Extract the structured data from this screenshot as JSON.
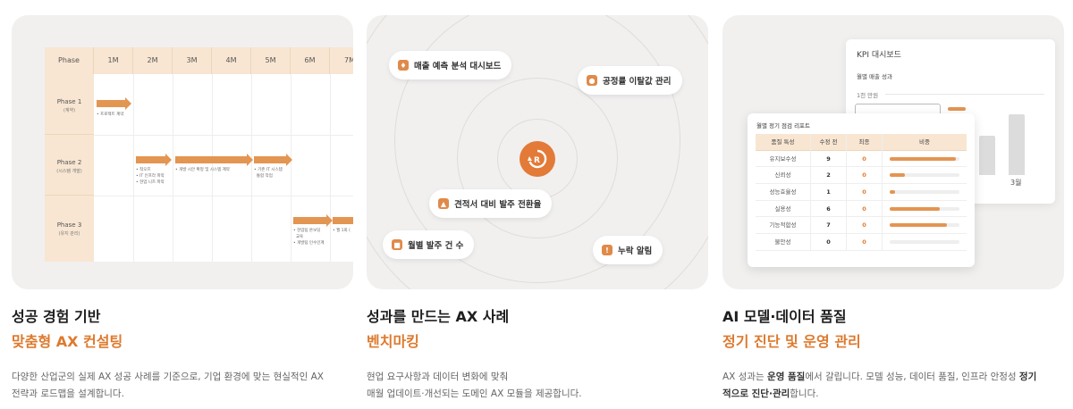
{
  "gantt": {
    "header_label": "Phase",
    "months": [
      "1M",
      "2M",
      "3M",
      "4M",
      "5M",
      "6M",
      "7M"
    ],
    "phases": [
      {
        "name": "Phase 1",
        "sub": "(계약)"
      },
      {
        "name": "Phase 2",
        "sub": "(시스템 개발)"
      },
      {
        "name": "Phase 3",
        "sub": "(유지 관리)"
      }
    ],
    "tasks": [
      "• 프로젝트 계약",
      "• 착오프\n• IT 인프라 파악\n• 현업 니즈 파악",
      "• 개발 시안 확정 및 시스템 계약",
      "• 기존 IT 시스템\n  통합 작업",
      "• 현업팀 온보딩\n  교육\n• 개발팀 인수인계",
      "• 월 1회 ("
    ]
  },
  "pills": [
    {
      "label": "매출 예측 분석 대시보드",
      "icon": "thumbs-up-icon"
    },
    {
      "label": "공정률 이탈값 관리",
      "icon": "person-icon"
    },
    {
      "label": "견적서 대비 발주 전환율",
      "icon": "bell-icon"
    },
    {
      "label": "월별 발주 건 수",
      "icon": "stack-icon"
    },
    {
      "label": "누락 알림",
      "icon": "alert-icon"
    }
  ],
  "kpi": {
    "title": "KPI 대시보드",
    "subtitle": "월별 매출 성과",
    "unit": "1천 만원",
    "month_label": "3월",
    "bars": [
      0.55,
      0.85
    ]
  },
  "report": {
    "title": "월별 정기 점검 리포트",
    "headers": [
      "품질 특성",
      "수정 전",
      "최종",
      "비중"
    ],
    "rows": [
      {
        "name": "유지보수성",
        "before": "9",
        "final": "0",
        "ratio": 0.95
      },
      {
        "name": "신뢰성",
        "before": "2",
        "final": "0",
        "ratio": 0.22
      },
      {
        "name": "성능효율성",
        "before": "1",
        "final": "0",
        "ratio": 0.08
      },
      {
        "name": "실용성",
        "before": "6",
        "final": "0",
        "ratio": 0.72
      },
      {
        "name": "기능적합성",
        "before": "7",
        "final": "0",
        "ratio": 0.82
      },
      {
        "name": "불안성",
        "before": "0",
        "final": "0",
        "ratio": 0
      }
    ]
  },
  "captions": [
    {
      "title": "성공 경험 기반",
      "subtitle": "맞춤형 AX 컨설팅",
      "desc_line1": "다양한 산업군의 실제 AX 성공 사례를 기준으로, 기업 환경에 맞는 현실적인 AX",
      "desc_line2": "전략과 로드맵을 설계합니다."
    },
    {
      "title": "성과를 만드는 AX 사례",
      "subtitle": "벤치마킹",
      "desc_line1": "현업 요구사항과 데이터 변화에 맞춰",
      "desc_line2": "매월 업데이트·개선되는 도메인 AX 모듈을 제공합니다."
    },
    {
      "title": "AI 모델·데이터 품질",
      "subtitle": "정기 진단 및 운영 관리",
      "desc_part1": "AX 성과는 ",
      "desc_bold1": "운영 품질",
      "desc_part2": "에서 갈립니다. 모델 성능, 데이터 품질, 인프라 안정성 ",
      "desc_bold2": "정기",
      "desc_bold3": "적으로 진단·관리",
      "desc_part3": "합니다."
    }
  ],
  "colors": {
    "accent": "#dd7a2e",
    "card_bg": "#f1f0ef",
    "header_bg": "#f8e6d2"
  }
}
